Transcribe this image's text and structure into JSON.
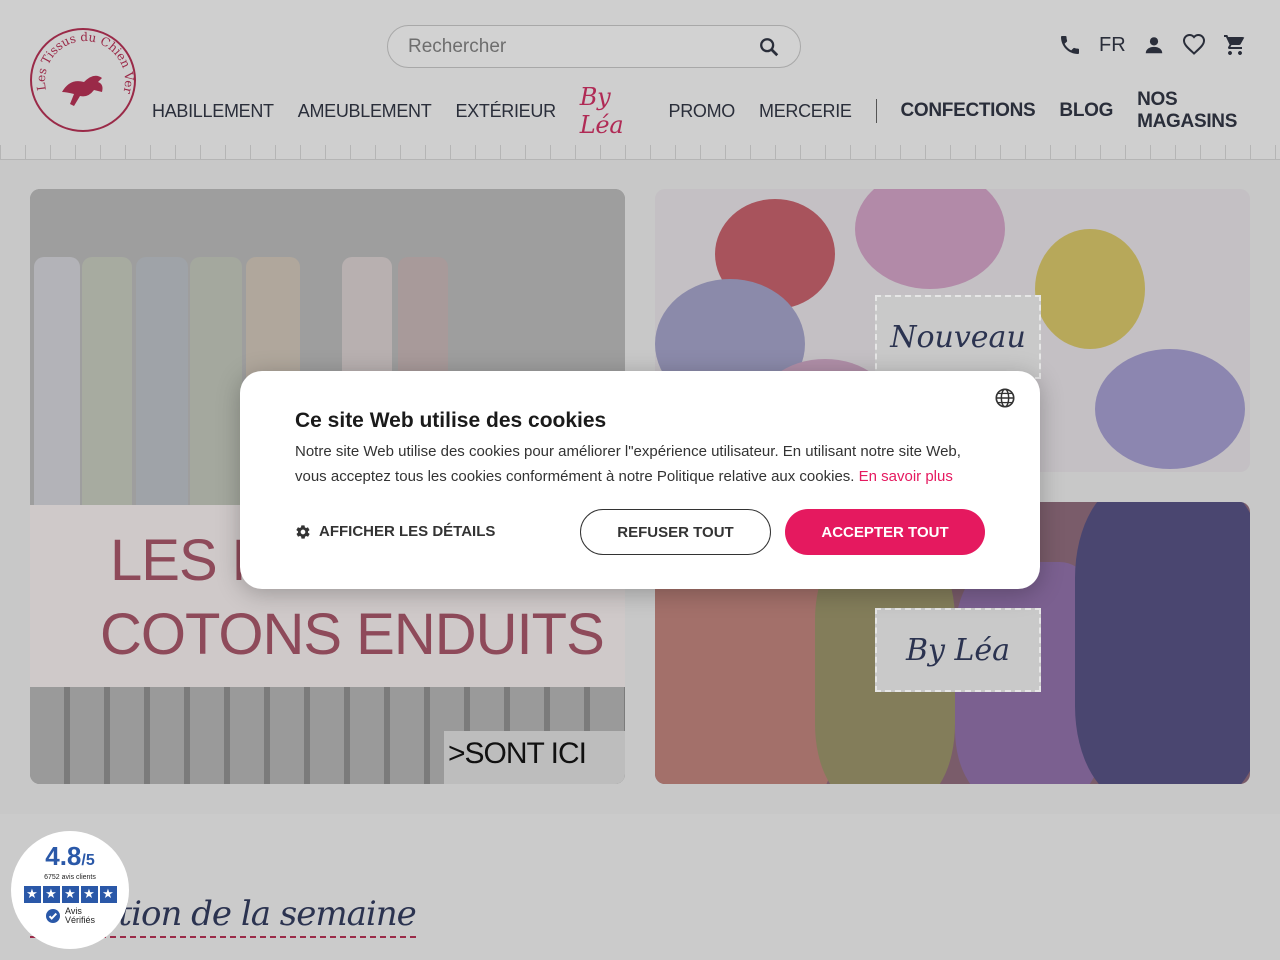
{
  "brand": {
    "logo_text": "Les Tissus du Chien Vert"
  },
  "search": {
    "placeholder": "Rechercher"
  },
  "header": {
    "lang": "FR"
  },
  "nav": {
    "items": [
      "HABILLEMENT",
      "AMEUBLEMENT",
      "EXTÉRIEUR",
      "By Léa",
      "PROMO",
      "MERCERIE"
    ],
    "bold_items": [
      "CONFECTIONS",
      "BLOG",
      "NOS MAGASINS"
    ]
  },
  "banners": {
    "left_line1": "LES N",
    "left_line2": "COTONS ENDUITS",
    "left_cta": ">SONT ICI",
    "right_top_tag": "Nouveau",
    "right_bottom_tag": "By Léa"
  },
  "section": {
    "title": "Sélection de la semaine"
  },
  "reviews": {
    "score": "4.8",
    "out_of": "/5",
    "count": "6752 avis clients",
    "brand_line1": "Avis",
    "brand_line2": "Vérifiés"
  },
  "cookie": {
    "title": "Ce site Web utilise des cookies",
    "text": "Notre site Web utilise des cookies pour améliorer l\"expérience utilisateur. En utilisant notre site Web, vous acceptez tous les cookies conformément à notre Politique relative aux cookies.",
    "link": "En savoir plus",
    "details": "AFFICHER LES DÉTAILS",
    "refuse": "REFUSER TOUT",
    "accept": "ACCEPTER TOUT"
  },
  "colors": {
    "accent": "#e5195f",
    "navy": "#2a2e3a",
    "brand_red": "#9a2a48",
    "reviews_blue": "#2a58a8"
  }
}
